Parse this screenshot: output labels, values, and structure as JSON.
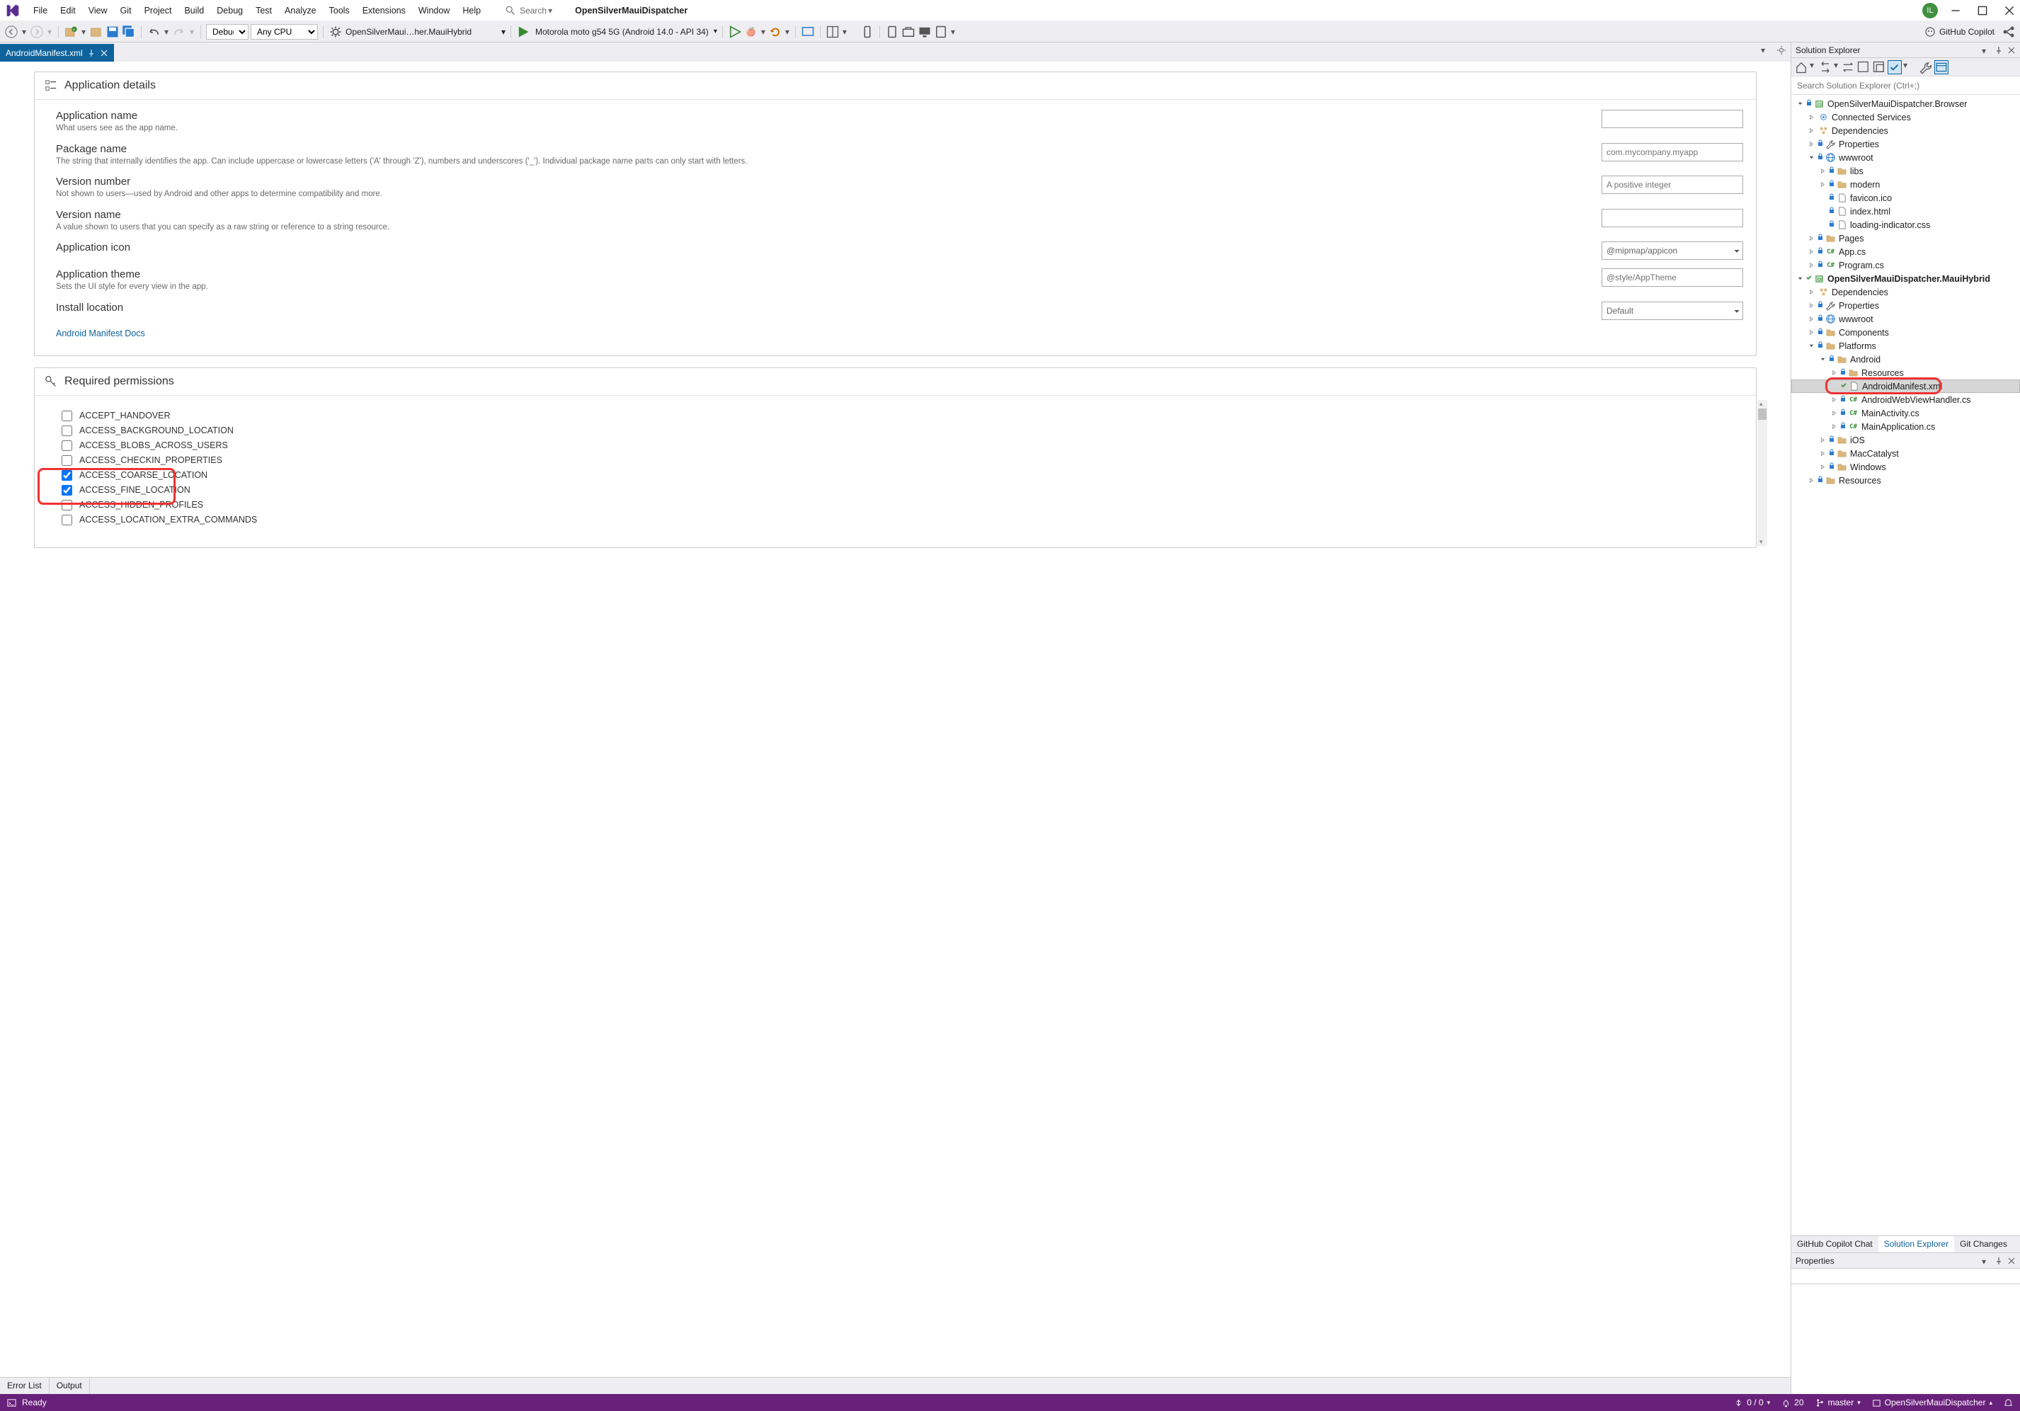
{
  "titlebar": {
    "menus": [
      "File",
      "Edit",
      "View",
      "Git",
      "Project",
      "Build",
      "Debug",
      "Test",
      "Analyze",
      "Tools",
      "Extensions",
      "Window",
      "Help"
    ],
    "search_label": "Search",
    "doc_title": "OpenSilverMauiDispatcher",
    "avatar_initials": "IL"
  },
  "toolbar": {
    "config": "Debug",
    "platform": "Any CPU",
    "project": "OpenSilverMaui…her.MauiHybrid",
    "target": "Motorola moto g54 5G (Android 14.0 - API 34)",
    "copilot_label": "GitHub Copilot"
  },
  "tab": {
    "title": "AndroidManifest.xml"
  },
  "manifest": {
    "section1_title": "Application details",
    "fields": [
      {
        "label": "Application name",
        "sub": "What users see as the app name.",
        "type": "text",
        "ph": "",
        "val": ""
      },
      {
        "label": "Package name",
        "sub": "The string that internally identifies the app. Can include uppercase or lowercase letters ('A' through 'Z'), numbers and underscores ('_'). Individual package name parts can only start with letters.",
        "type": "text",
        "ph": "com.mycompany.myapp",
        "val": ""
      },
      {
        "label": "Version number",
        "sub": "Not shown to users—used by Android and other apps to determine compatibility and more.",
        "type": "text",
        "ph": "A positive integer",
        "val": ""
      },
      {
        "label": "Version name",
        "sub": "A value shown to users that you can specify as a raw string or reference to a string resource.",
        "type": "text",
        "ph": "",
        "val": ""
      },
      {
        "label": "Application icon",
        "sub": "",
        "type": "select",
        "val": "@mipmap/appicon"
      },
      {
        "label": "Application theme",
        "sub": "Sets the UI style for every view in the app.",
        "type": "text",
        "ph": "@style/AppTheme",
        "val": ""
      },
      {
        "label": "Install location",
        "sub": "",
        "type": "select",
        "val": "Default"
      }
    ],
    "docs_link": "Android Manifest Docs",
    "section2_title": "Required permissions",
    "permissions": [
      {
        "name": "ACCEPT_HANDOVER",
        "checked": false
      },
      {
        "name": "ACCESS_BACKGROUND_LOCATION",
        "checked": false
      },
      {
        "name": "ACCESS_BLOBS_ACROSS_USERS",
        "checked": false
      },
      {
        "name": "ACCESS_CHECKIN_PROPERTIES",
        "checked": false
      },
      {
        "name": "ACCESS_COARSE_LOCATION",
        "checked": true
      },
      {
        "name": "ACCESS_FINE_LOCATION",
        "checked": true
      },
      {
        "name": "ACCESS_HIDDEN_PROFILES",
        "checked": false
      },
      {
        "name": "ACCESS_LOCATION_EXTRA_COMMANDS",
        "checked": false
      }
    ]
  },
  "solution_explorer": {
    "title": "Solution Explorer",
    "search_ph": "Search Solution Explorer (Ctrl+;)",
    "tree": [
      {
        "d": 0,
        "exp": "open",
        "bold": false,
        "icon": "proj",
        "lock": true,
        "text": "OpenSilverMauiDispatcher.Browser"
      },
      {
        "d": 1,
        "exp": "closed",
        "bold": false,
        "icon": "conn",
        "lock": false,
        "text": "Connected Services"
      },
      {
        "d": 1,
        "exp": "closed",
        "bold": false,
        "icon": "deps",
        "lock": false,
        "text": "Dependencies"
      },
      {
        "d": 1,
        "exp": "closed",
        "bold": false,
        "icon": "wrench",
        "lock": true,
        "text": "Properties"
      },
      {
        "d": 1,
        "exp": "open",
        "bold": false,
        "icon": "globe",
        "lock": true,
        "text": "wwwroot"
      },
      {
        "d": 2,
        "exp": "closed",
        "bold": false,
        "icon": "folder",
        "lock": true,
        "text": "libs"
      },
      {
        "d": 2,
        "exp": "closed",
        "bold": false,
        "icon": "folder",
        "lock": true,
        "text": "modern"
      },
      {
        "d": 2,
        "exp": "none",
        "bold": false,
        "icon": "file",
        "lock": true,
        "text": "favicon.ico"
      },
      {
        "d": 2,
        "exp": "none",
        "bold": false,
        "icon": "file",
        "lock": true,
        "text": "index.html"
      },
      {
        "d": 2,
        "exp": "none",
        "bold": false,
        "icon": "file",
        "lock": true,
        "text": "loading-indicator.css"
      },
      {
        "d": 1,
        "exp": "closed",
        "bold": false,
        "icon": "folder",
        "lock": true,
        "text": "Pages"
      },
      {
        "d": 1,
        "exp": "closed",
        "bold": false,
        "icon": "cs",
        "lock": true,
        "text": "App.cs"
      },
      {
        "d": 1,
        "exp": "closed",
        "bold": false,
        "icon": "cs",
        "lock": true,
        "text": "Program.cs"
      },
      {
        "d": 0,
        "exp": "open",
        "bold": true,
        "icon": "proj",
        "lock": false,
        "check": true,
        "text": "OpenSilverMauiDispatcher.MauiHybrid"
      },
      {
        "d": 1,
        "exp": "closed",
        "bold": false,
        "icon": "deps",
        "lock": false,
        "text": "Dependencies"
      },
      {
        "d": 1,
        "exp": "closed",
        "bold": false,
        "icon": "wrench",
        "lock": true,
        "text": "Properties"
      },
      {
        "d": 1,
        "exp": "closed",
        "bold": false,
        "icon": "globe",
        "lock": true,
        "text": "wwwroot"
      },
      {
        "d": 1,
        "exp": "closed",
        "bold": false,
        "icon": "folder",
        "lock": true,
        "text": "Components"
      },
      {
        "d": 1,
        "exp": "open",
        "bold": false,
        "icon": "folder",
        "lock": true,
        "text": "Platforms"
      },
      {
        "d": 2,
        "exp": "open",
        "bold": false,
        "icon": "folder",
        "lock": true,
        "text": "Android"
      },
      {
        "d": 3,
        "exp": "closed",
        "bold": false,
        "icon": "folder",
        "lock": true,
        "text": "Resources"
      },
      {
        "d": 3,
        "exp": "none",
        "bold": false,
        "icon": "file",
        "lock": false,
        "check": true,
        "sel": true,
        "text": "AndroidManifest.xml",
        "hl": true
      },
      {
        "d": 3,
        "exp": "closed",
        "bold": false,
        "icon": "cs",
        "lock": true,
        "text": "AndroidWebViewHandler.cs"
      },
      {
        "d": 3,
        "exp": "closed",
        "bold": false,
        "icon": "cs",
        "lock": true,
        "text": "MainActivity.cs"
      },
      {
        "d": 3,
        "exp": "closed",
        "bold": false,
        "icon": "cs",
        "lock": true,
        "text": "MainApplication.cs"
      },
      {
        "d": 2,
        "exp": "closed",
        "bold": false,
        "icon": "folder",
        "lock": true,
        "text": "iOS"
      },
      {
        "d": 2,
        "exp": "closed",
        "bold": false,
        "icon": "folder",
        "lock": true,
        "text": "MacCatalyst"
      },
      {
        "d": 2,
        "exp": "closed",
        "bold": false,
        "icon": "folder",
        "lock": true,
        "text": "Windows"
      },
      {
        "d": 1,
        "exp": "closed",
        "bold": false,
        "icon": "folder",
        "lock": true,
        "text": "Resources"
      }
    ],
    "bottom_tabs": [
      "GitHub Copilot Chat",
      "Solution Explorer",
      "Git Changes"
    ],
    "bottom_active": 1
  },
  "properties": {
    "title": "Properties"
  },
  "editor_bottom_tabs": [
    "Error List",
    "Output"
  ],
  "status": {
    "ready": "Ready",
    "changes": "0 / 0",
    "commits": "20",
    "branch": "master",
    "project": "OpenSilverMauiDispatcher"
  }
}
